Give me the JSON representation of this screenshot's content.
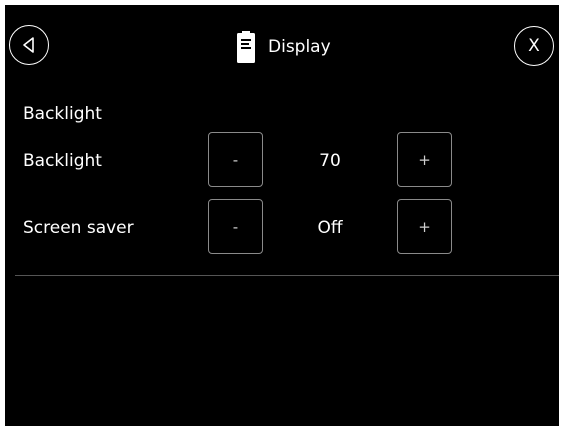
{
  "header": {
    "title": "Display",
    "back_icon": "chevron-left-circle-icon",
    "close_label": "X",
    "doc_icon": "document-icon"
  },
  "section": {
    "heading": "Backlight"
  },
  "settings": [
    {
      "label": "Backlight",
      "value": "70",
      "decrement_label": "-",
      "increment_label": "+"
    },
    {
      "label": "Screen saver",
      "value": "Off",
      "decrement_label": "-",
      "increment_label": "+"
    }
  ],
  "colors": {
    "background": "#000000",
    "text": "#ffffff",
    "button_border": "#8a8a8a",
    "divider": "#555555"
  }
}
